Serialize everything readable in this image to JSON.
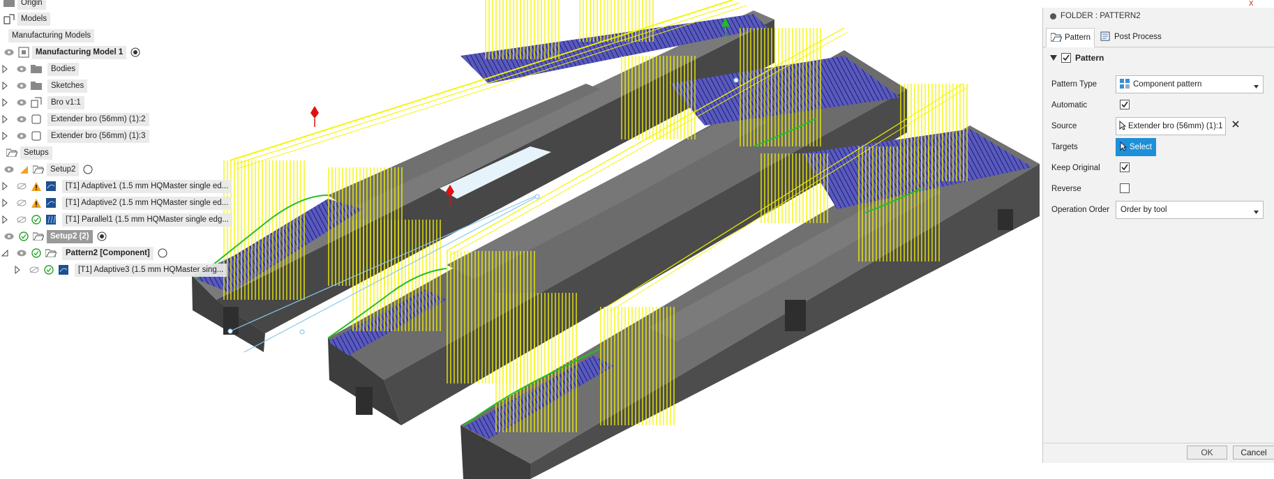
{
  "browser": {
    "items": [
      {
        "label": "Origin"
      },
      {
        "label": "Models"
      },
      {
        "label": "Manufacturing Models"
      },
      {
        "label": "Manufacturing Model 1"
      },
      {
        "label": "Bodies"
      },
      {
        "label": "Sketches"
      },
      {
        "label": "Bro v1:1"
      },
      {
        "label": "Extender bro (56mm) (1):2"
      },
      {
        "label": "Extender bro (56mm) (1):3"
      },
      {
        "label": "Setups"
      },
      {
        "label": "Setup2"
      },
      {
        "label": "[T1] Adaptive1 (1.5 mm HQMaster single ed..."
      },
      {
        "label": "[T1] Adaptive2 (1.5 mm HQMaster single ed..."
      },
      {
        "label": "[T1] Parallel1 (1.5 mm HQMaster single edg..."
      },
      {
        "label": "Setup2 (2)"
      },
      {
        "label": "Pattern2 [Component]"
      },
      {
        "label": "[T1] Adaptive3 (1.5 mm HQMaster sing..."
      }
    ]
  },
  "viewport": {
    "close_glyph": "x"
  },
  "panel": {
    "title": "FOLDER : PATTERN2",
    "tabs": [
      {
        "label": "Pattern"
      },
      {
        "label": "Post Process"
      }
    ],
    "section_label": "Pattern",
    "section_checked": true,
    "fields": {
      "pattern_type": {
        "label": "Pattern Type",
        "value": "Component pattern"
      },
      "automatic": {
        "label": "Automatic",
        "checked": true
      },
      "source": {
        "label": "Source",
        "value": "Extender bro (56mm) (1):1"
      },
      "targets": {
        "label": "Targets",
        "button": "Select"
      },
      "keep_original": {
        "label": "Keep Original",
        "checked": true
      },
      "reverse": {
        "label": "Reverse",
        "checked": false
      },
      "operation_order": {
        "label": "Operation Order",
        "value": "Order by tool"
      }
    },
    "ok_label": "OK",
    "cancel_label": "Cancel"
  },
  "colors": {
    "toolpath_yellow": "#ffff00",
    "toolpath_blue": "#1a1aa0",
    "toolpath_green": "#22c022",
    "part_gray": "#4b4b4b",
    "select_blue": "#1e90d8"
  }
}
